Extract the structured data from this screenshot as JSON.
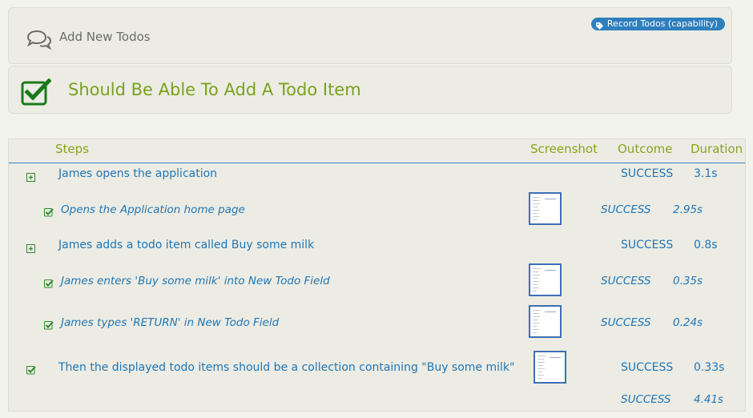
{
  "story": {
    "title": "Add New Todos",
    "icon": "chat-bubbles-icon",
    "tag": {
      "label": "Record Todos (capability)",
      "icon": "tag-icon",
      "color": "#2e7fbe"
    }
  },
  "scenario": {
    "title": "Should Be Able To Add A Todo Item",
    "icon": "checkbox-checked-icon",
    "accent": "#7aa11e"
  },
  "table": {
    "headers": {
      "steps": "Steps",
      "screenshot": "Screenshot",
      "outcome": "Outcome",
      "duration": "Duration"
    },
    "rows": [
      {
        "text": "James opens the application",
        "outcome": "SUCCESS",
        "duration": "3.1s",
        "kind": "group",
        "icon": "expand-plus-icon"
      },
      {
        "text": "Opens the Application home page",
        "outcome": "SUCCESS",
        "duration": "2.95s",
        "kind": "substep",
        "icon": "check-icon",
        "has_screenshot": true
      },
      {
        "text": "James adds a todo item called Buy some milk",
        "outcome": "SUCCESS",
        "duration": "0.8s",
        "kind": "group",
        "icon": "expand-plus-icon"
      },
      {
        "text": "James enters 'Buy some milk' into New Todo Field",
        "outcome": "SUCCESS",
        "duration": "0.35s",
        "kind": "substep",
        "icon": "check-icon",
        "has_screenshot": true
      },
      {
        "text": "James types 'RETURN' in New Todo Field",
        "outcome": "SUCCESS",
        "duration": "0.24s",
        "kind": "substep",
        "icon": "check-icon",
        "has_screenshot": true
      },
      {
        "text": "Then the displayed todo items should be a collection containing \"Buy some milk\"",
        "outcome": "SUCCESS",
        "duration": "0.33s",
        "kind": "step",
        "icon": "check-icon",
        "has_screenshot": true
      }
    ],
    "total": {
      "outcome": "SUCCESS",
      "duration": "4.41s"
    }
  }
}
